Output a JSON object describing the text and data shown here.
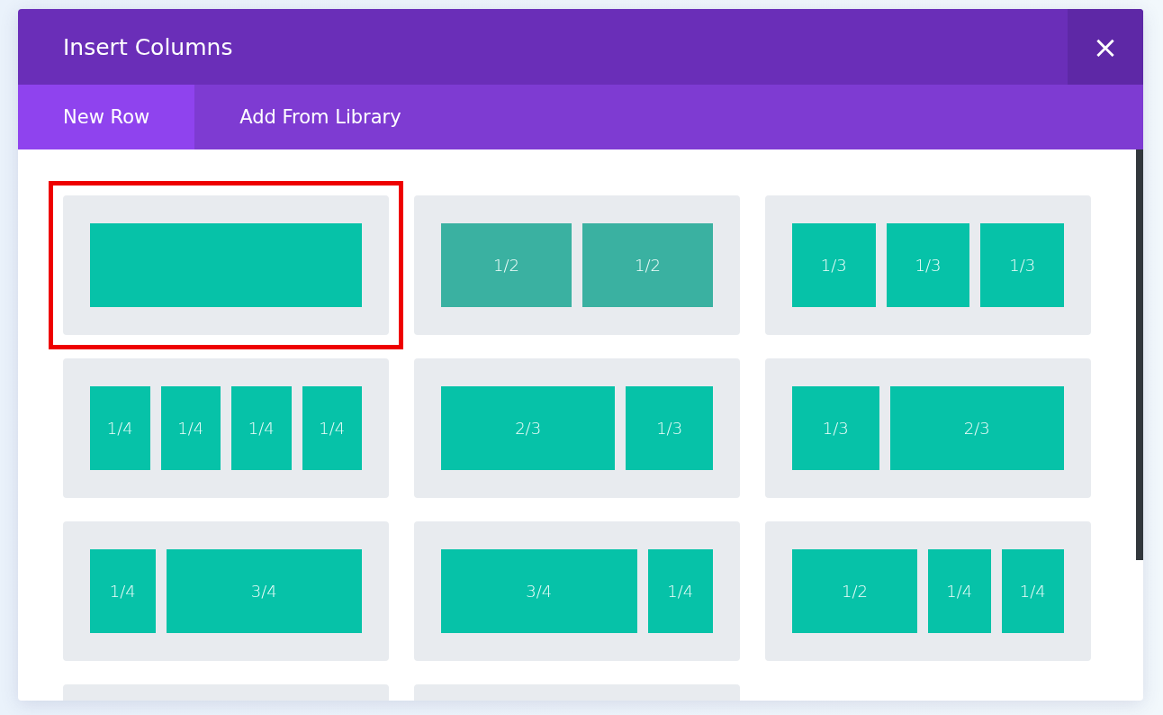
{
  "modal": {
    "title": "Insert Columns",
    "close": "×"
  },
  "tabs": [
    {
      "label": "New Row",
      "selected": true
    },
    {
      "label": "Add From Library",
      "selected": false
    }
  ],
  "layouts": [
    {
      "selected": true,
      "hovered": false,
      "columns": [
        {
          "kind": "full"
        }
      ]
    },
    {
      "selected": false,
      "hovered": true,
      "columns": [
        {
          "kind": "half",
          "label": "1/2"
        },
        {
          "kind": "half",
          "label": "1/2"
        }
      ]
    },
    {
      "selected": false,
      "hovered": false,
      "columns": [
        {
          "kind": "third",
          "label": "1/3"
        },
        {
          "kind": "third",
          "label": "1/3"
        },
        {
          "kind": "third",
          "label": "1/3"
        }
      ]
    },
    {
      "selected": false,
      "hovered": false,
      "columns": [
        {
          "kind": "quarter",
          "label": "1/4"
        },
        {
          "kind": "quarter",
          "label": "1/4"
        },
        {
          "kind": "quarter",
          "label": "1/4"
        },
        {
          "kind": "quarter",
          "label": "1/4"
        }
      ]
    },
    {
      "selected": false,
      "hovered": false,
      "columns": [
        {
          "kind": "two-thirds",
          "label": "2/3"
        },
        {
          "kind": "third",
          "label": "1/3"
        }
      ]
    },
    {
      "selected": false,
      "hovered": false,
      "columns": [
        {
          "kind": "third",
          "label": "1/3"
        },
        {
          "kind": "two-thirds",
          "label": "2/3"
        }
      ]
    },
    {
      "selected": false,
      "hovered": false,
      "columns": [
        {
          "kind": "quarter",
          "label": "1/4"
        },
        {
          "kind": "three-quarters",
          "label": "3/4"
        }
      ]
    },
    {
      "selected": false,
      "hovered": false,
      "columns": [
        {
          "kind": "three-quarters",
          "label": "3/4"
        },
        {
          "kind": "quarter",
          "label": "1/4"
        }
      ]
    },
    {
      "selected": false,
      "hovered": false,
      "columns": [
        {
          "kind": "half",
          "label": "1/2"
        },
        {
          "kind": "quarter",
          "label": "1/4"
        },
        {
          "kind": "quarter",
          "label": "1/4"
        }
      ]
    },
    {
      "selected": false
    },
    {
      "selected": false
    }
  ]
}
